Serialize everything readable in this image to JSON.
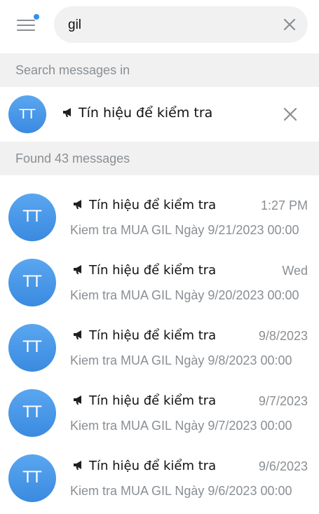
{
  "search": {
    "query": "gil"
  },
  "sections": {
    "search_in_label": "Search messages in",
    "found_label": "Found 43 messages"
  },
  "chip": {
    "avatar_initials": "TT",
    "title": "Tín hiệu để kiểm tra"
  },
  "results": [
    {
      "avatar_initials": "TT",
      "title": "Tín hiệu để kiểm tra",
      "time": "1:27 PM",
      "preview": "Kiem tra MUA GIL Ngày 9/21/2023 00:00"
    },
    {
      "avatar_initials": "TT",
      "title": "Tín hiệu để kiểm tra",
      "time": "Wed",
      "preview": "Kiem tra MUA GIL Ngày 9/20/2023 00:00"
    },
    {
      "avatar_initials": "TT",
      "title": "Tín hiệu để kiểm tra",
      "time": "9/8/2023",
      "preview": "Kiem tra MUA GIL Ngày 9/8/2023 00:00"
    },
    {
      "avatar_initials": "TT",
      "title": "Tín hiệu để kiểm tra",
      "time": "9/7/2023",
      "preview": "Kiem tra MUA GIL Ngày 9/7/2023 00:00"
    },
    {
      "avatar_initials": "TT",
      "title": "Tín hiệu để kiểm tra",
      "time": "9/6/2023",
      "preview": "Kiem tra MUA GIL Ngày 9/6/2023 00:00"
    }
  ],
  "icons": {
    "menu": "menu-icon",
    "clear": "close-icon",
    "channel": "megaphone-icon"
  },
  "colors": {
    "accent": "#3390ec",
    "avatar": "#4a98e8",
    "muted_text": "#8a8f94",
    "section_bg": "#f1f1f1"
  }
}
